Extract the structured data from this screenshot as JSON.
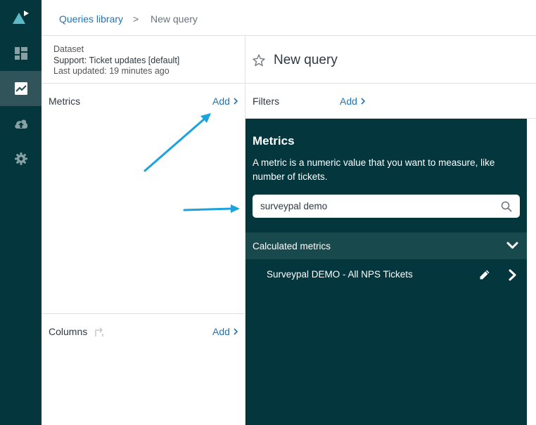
{
  "colors": {
    "nav_bg": "#03363d",
    "nav_active": "#30545a",
    "link": "#1f73b7",
    "picker_bg": "#03363d",
    "group_bg": "#17494d",
    "annotation": "#1ba3dd"
  },
  "nav": {
    "items": [
      {
        "icon": "logo-icon"
      },
      {
        "icon": "dashboard-icon"
      },
      {
        "icon": "reporting-icon",
        "active": true
      },
      {
        "icon": "cloud-upload-icon"
      },
      {
        "icon": "gear-icon"
      }
    ]
  },
  "breadcrumb": {
    "library": "Queries library",
    "separator": ">",
    "current": "New query"
  },
  "dataset": {
    "label": "Dataset",
    "name": "Support: Ticket updates [default]",
    "updated": "Last updated: 19 minutes ago"
  },
  "metrics_section": {
    "title": "Metrics",
    "add_label": "Add"
  },
  "columns_section": {
    "title": "Columns",
    "add_label": "Add"
  },
  "query": {
    "title": "New query"
  },
  "filters": {
    "label": "Filters",
    "add_label": "Add"
  },
  "picker": {
    "title": "Metrics",
    "description": "A metric is a numeric value that you want to measure, like number of tickets.",
    "search_value": "surveypal demo",
    "group_label": "Calculated metrics",
    "items": [
      {
        "label": "Surveypal DEMO - All NPS Tickets"
      }
    ]
  }
}
